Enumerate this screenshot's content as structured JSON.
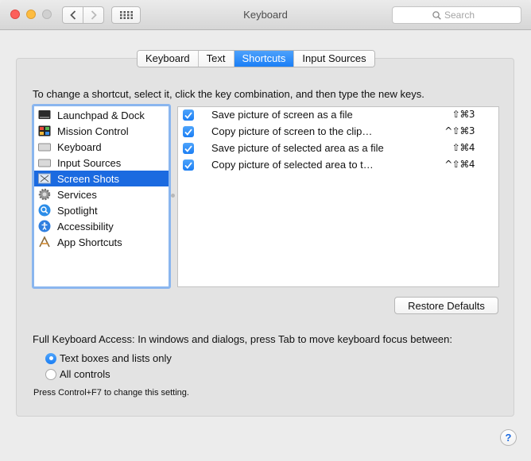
{
  "window": {
    "title": "Keyboard"
  },
  "toolbar": {
    "search_placeholder": "Search",
    "back_icon": "chevron-left-icon",
    "forward_icon": "chevron-right-icon",
    "grid_icon": "grid-icon"
  },
  "tabs": [
    {
      "label": "Keyboard",
      "active": false
    },
    {
      "label": "Text",
      "active": false
    },
    {
      "label": "Shortcuts",
      "active": true
    },
    {
      "label": "Input Sources",
      "active": false
    }
  ],
  "instructions": "To change a shortcut, select it, click the key combination, and then type the new keys.",
  "categories": [
    {
      "label": "Launchpad & Dock",
      "icon": "launchpad-icon",
      "selected": false
    },
    {
      "label": "Mission Control",
      "icon": "mission-control-icon",
      "selected": false
    },
    {
      "label": "Keyboard",
      "icon": "keyboard-icon",
      "selected": false
    },
    {
      "label": "Input Sources",
      "icon": "input-sources-icon",
      "selected": false
    },
    {
      "label": "Screen Shots",
      "icon": "screen-shots-icon",
      "selected": true
    },
    {
      "label": "Services",
      "icon": "gear-icon",
      "selected": false
    },
    {
      "label": "Spotlight",
      "icon": "spotlight-icon",
      "selected": false
    },
    {
      "label": "Accessibility",
      "icon": "accessibility-icon",
      "selected": false
    },
    {
      "label": "App Shortcuts",
      "icon": "app-shortcuts-icon",
      "selected": false
    }
  ],
  "shortcuts": [
    {
      "name": "Save picture of screen as a file",
      "keys": "⇧⌘3",
      "checked": true
    },
    {
      "name": "Copy picture of screen to the clip…",
      "keys": "^⇧⌘3",
      "checked": true
    },
    {
      "name": "Save picture of selected area as a file",
      "keys": "⇧⌘4",
      "checked": true
    },
    {
      "name": "Copy picture of selected area to t…",
      "keys": "^⇧⌘4",
      "checked": true
    }
  ],
  "restore_label": "Restore Defaults",
  "full_keyboard_access": {
    "text": "Full Keyboard Access: In windows and dialogs, press Tab to move keyboard focus between:",
    "options": [
      {
        "label": "Text boxes and lists only",
        "selected": true
      },
      {
        "label": "All controls",
        "selected": false
      }
    ],
    "hint": "Press Control+F7 to change this setting."
  },
  "help_label": "?",
  "colors": {
    "accent": "#1b6ae0",
    "selection": "#1b6ae0",
    "tab_active": "#1a7ff6"
  }
}
